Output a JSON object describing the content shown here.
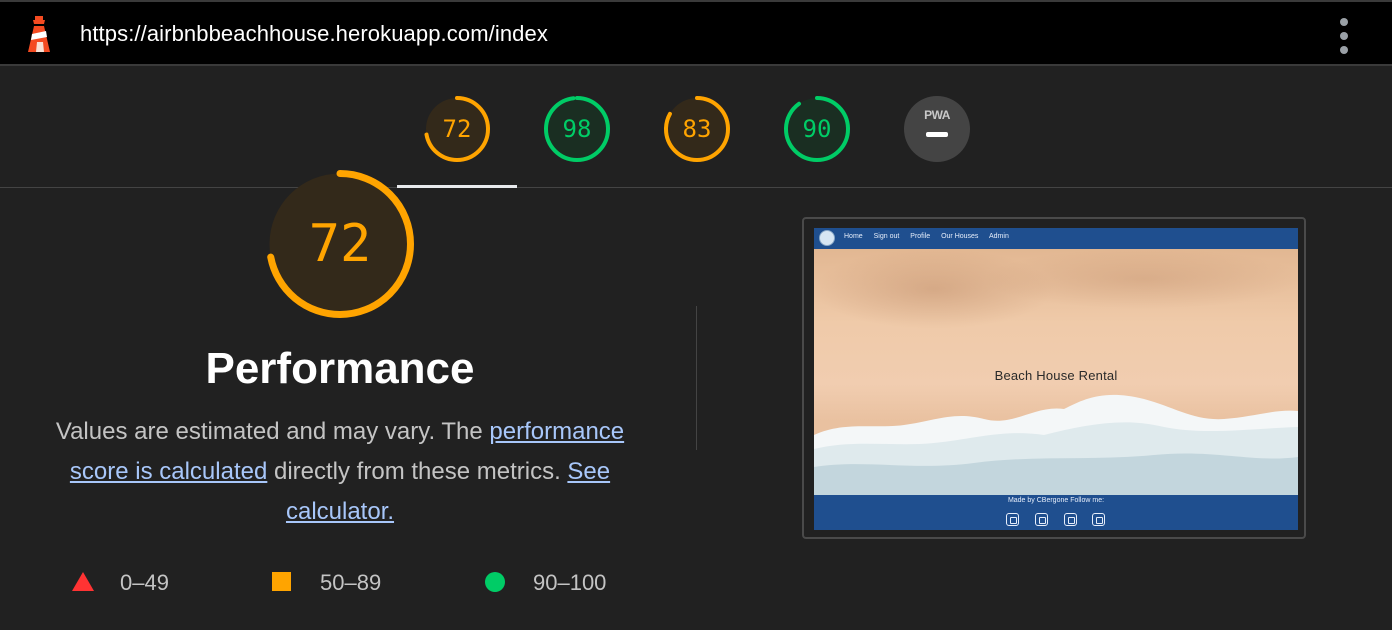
{
  "header": {
    "url": "https://airbnbbeachhouse.herokuapp.com/index",
    "logo_icon": "lighthouse-icon",
    "menu_icon": "kebab-menu-icon"
  },
  "gauges": [
    {
      "id": "performance",
      "score": "72",
      "value": 72,
      "color": "#ffa400",
      "bg": "#33291a"
    },
    {
      "id": "accessibility",
      "score": "98",
      "value": 98,
      "color": "#0c6",
      "bg": "#1a2e22"
    },
    {
      "id": "best-practices",
      "score": "83",
      "value": 83,
      "color": "#ffa400",
      "bg": "#33291a"
    },
    {
      "id": "seo",
      "score": "90",
      "value": 90,
      "color": "#0c6",
      "bg": "#1a2e22"
    }
  ],
  "pwa": {
    "label": "PWA"
  },
  "performance": {
    "score": "72",
    "value": 72,
    "title": "Performance",
    "desc_prefix": "Values are estimated and may vary. The ",
    "link1": "performance score is calculated",
    "desc_middle": " directly from these metrics. ",
    "link2": "See calculator."
  },
  "legend": [
    {
      "shape": "triangle",
      "range": "0–49",
      "color": "#ff3333"
    },
    {
      "shape": "square",
      "range": "50–89",
      "color": "#ffa400"
    },
    {
      "shape": "circle",
      "range": "90–100",
      "color": "#00cc66"
    }
  ],
  "screenshot": {
    "nav_links": [
      "Home",
      "Sign out",
      "Profile",
      "Our Houses",
      "Admin"
    ],
    "hero_title": "Beach House Rental",
    "footer_text": "Made by CBergone Follow me:",
    "social_icons": [
      "facebook-icon",
      "linkedin-icon",
      "instagram-icon",
      "github-icon"
    ]
  }
}
